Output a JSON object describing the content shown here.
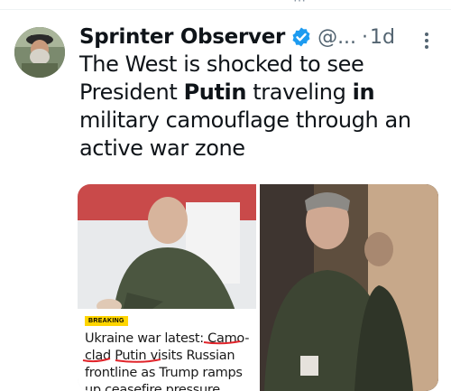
{
  "author": {
    "name": "Sprinter Observer",
    "handle": "@...",
    "time": "1d",
    "separator": "·"
  },
  "tweet": {
    "segments": [
      {
        "text": "The West is shocked to see President ",
        "bold": false
      },
      {
        "text": "Putin",
        "bold": true
      },
      {
        "text": " traveling ",
        "bold": false
      },
      {
        "text": "in",
        "bold": true
      },
      {
        "text": " military camouflage through an active war zone",
        "bold": false
      }
    ]
  },
  "media": {
    "card": {
      "badge": "BREAKING",
      "headline_lines": [
        "Ukraine war latest: Camo-",
        "clad Putin visits Russian",
        "frontline as Trump ramps",
        "up ceasefire pressure"
      ]
    }
  },
  "icons": {
    "avatar": "avatar-image",
    "verified": "verified-badge-icon",
    "more": "more-options-icon"
  },
  "colors": {
    "verified": "#1d9bf0",
    "secondary_text": "#536471",
    "badge": "#ffd500",
    "underline": "#e0242a"
  }
}
